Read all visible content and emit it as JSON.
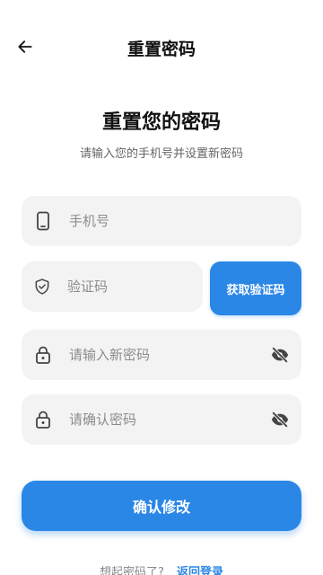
{
  "header": {
    "title": "重置密码",
    "back_icon": "arrow-left-icon"
  },
  "hero": {
    "title": "重置您的密码",
    "subtitle": "请输入您的手机号并设置新密码"
  },
  "form": {
    "phone": {
      "placeholder": "手机号",
      "icon": "phone-icon"
    },
    "code": {
      "placeholder": "验证码",
      "icon": "shield-check-icon"
    },
    "get_code_label": "获取验证码",
    "new_password": {
      "placeholder": "请输入新密码",
      "icon": "lock-icon",
      "visibility_icon": "eye-off-icon"
    },
    "confirm_password": {
      "placeholder": "请确认密码",
      "icon": "lock-icon",
      "visibility_icon": "eye-off-icon"
    },
    "submit_label": "确认修改"
  },
  "footer": {
    "prompt": "想起密码了?",
    "link_label": "返回登录"
  },
  "colors": {
    "accent": "#2a87e6",
    "field_bg": "#f3f3f3"
  }
}
